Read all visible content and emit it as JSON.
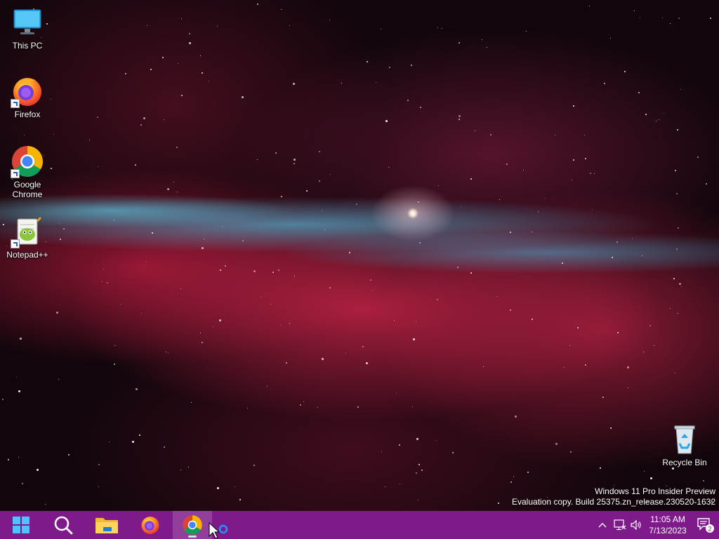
{
  "desktop": {
    "icons": [
      {
        "label": "This PC",
        "icon": "monitor-icon"
      },
      {
        "label": "Firefox",
        "icon": "firefox-icon"
      },
      {
        "label": "Google Chrome",
        "icon": "chrome-icon"
      },
      {
        "label": "Notepad++",
        "icon": "notepad-plus-plus-icon"
      },
      {
        "label": "Recycle Bin",
        "icon": "recycle-bin-icon"
      }
    ],
    "watermark": {
      "line1": "Windows 11 Pro Insider Preview",
      "line2": "Evaluation copy. Build 25375.zn_release.230520-1632"
    }
  },
  "taskbar": {
    "color": "#7e1a8a",
    "apps": [
      {
        "name": "Start",
        "icon": "windows-start-icon"
      },
      {
        "name": "Search",
        "icon": "search-icon"
      },
      {
        "name": "File Explorer",
        "icon": "folder-icon"
      },
      {
        "name": "Firefox",
        "icon": "firefox-icon"
      },
      {
        "name": "Google Chrome",
        "icon": "chrome-icon",
        "active": true
      }
    ],
    "tray": {
      "time": "11:05 AM",
      "date": "7/13/2023",
      "notification_count": "2"
    }
  }
}
